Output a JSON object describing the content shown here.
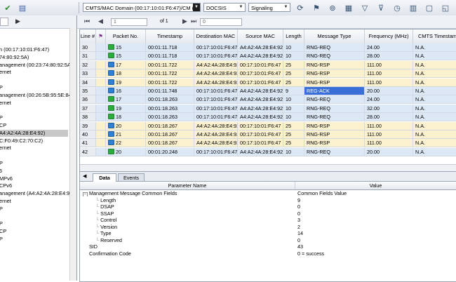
{
  "toolbar": {
    "filter_combo": "CMTS/MAC Domain (00:17:10:01:F6:47)/CM (A4:A2",
    "protocol_combo": "DOCSIS",
    "view_combo": "Signaling",
    "icons": [
      "funnel-check-icon",
      "save-doc-icon",
      "refresh-icon",
      "flag-icon",
      "binoculars-icon",
      "calendar-icon",
      "filter-icon",
      "filter-edit-icon",
      "clock-icon",
      "chart-icon",
      "window-icon"
    ]
  },
  "navigation": {
    "page_value": "1",
    "page_of": "of 1",
    "jump_value": "0"
  },
  "left_tree": {
    "lines": [
      "n (00:17:10:01:F6:47)",
      "74:80:92:5A)",
      "anagement (00:23:74:80:92:5A)",
      "ernet",
      "",
      "P",
      "anagement (00:26:5B:95:5E:84)",
      "ernet",
      "",
      "P",
      "CP",
      "A4:A2:4A:28:E4:92)",
      "C:F0:49:C2:70:C2)",
      "ernet",
      "",
      "P",
      "6",
      "MPv6",
      "CPv6",
      "anagement (A4:A2:4A:28:E4:92)",
      "ernet",
      "P",
      "",
      "P",
      "CP",
      "P"
    ],
    "selected_index": 11
  },
  "grid": {
    "columns": [
      "Line #",
      "⚑",
      "Packet No.",
      "Timestamp",
      "Destination MAC",
      "Source MAC",
      "Length",
      "Message Type",
      "Frequency (MHz)",
      "CMTS Timestam"
    ],
    "rows": [
      {
        "line": "30",
        "packet": "15",
        "timestamp": "00:01:11.718",
        "dst": "00:17:10:01:F6:47",
        "src": "A4:A2:4A:28:E4:92",
        "length": "10",
        "type": "RNG-REQ",
        "freq": "24.00",
        "cmts": "N.A.",
        "color": "#dde8f7",
        "icon": "#2eab3f",
        "selected": false
      },
      {
        "line": "31",
        "packet": "15",
        "timestamp": "00:01:11.718",
        "dst": "00:17:10:01:F6:47",
        "src": "A4:A2:4A:28:E4:92",
        "length": "10",
        "type": "RNG-REQ",
        "freq": "28.00",
        "cmts": "N.A.",
        "color": "#dde8f7",
        "icon": "#2eab3f",
        "selected": false
      },
      {
        "line": "32",
        "packet": "17",
        "timestamp": "00:01:11.722",
        "dst": "A4:A2:4A:28:E4:92",
        "src": "00:17:10:01:F6:47",
        "length": "25",
        "type": "RNG-RSP",
        "freq": "111.00",
        "cmts": "N.A.",
        "color": "#fbf1cf",
        "icon": "#2f7fd6",
        "selected": false
      },
      {
        "line": "33",
        "packet": "18",
        "timestamp": "00:01:11.722",
        "dst": "A4:A2:4A:28:E4:92",
        "src": "00:17:10:01:F6:47",
        "length": "25",
        "type": "RNG-RSP",
        "freq": "111.00",
        "cmts": "N.A.",
        "color": "#fbf1cf",
        "icon": "#2f7fd6",
        "selected": false
      },
      {
        "line": "34",
        "packet": "19",
        "timestamp": "00:01:11.722",
        "dst": "A4:A2:4A:28:E4:92",
        "src": "00:17:10:01:F6:47",
        "length": "25",
        "type": "RNG-RSP",
        "freq": "111.00",
        "cmts": "N.A.",
        "color": "#fbf1cf",
        "icon": "#2f7fd6",
        "selected": false
      },
      {
        "line": "35",
        "packet": "16",
        "timestamp": "00:01:11.748",
        "dst": "00:17:10:01:F6:47",
        "src": "A4:A2:4A:28:E4:92",
        "length": "9",
        "type": "REG-ACK",
        "freq": "20.00",
        "cmts": "N.A.",
        "color": "#dde8f7",
        "icon": "#2f7fd6",
        "selected": true
      },
      {
        "line": "36",
        "packet": "17",
        "timestamp": "00:01:18.263",
        "dst": "00:17:10:01:F6:47",
        "src": "A4:A2:4A:28:E4:92",
        "length": "10",
        "type": "RNG-REQ",
        "freq": "24.00",
        "cmts": "N.A.",
        "color": "#dde8f7",
        "icon": "#2eab3f",
        "selected": false
      },
      {
        "line": "37",
        "packet": "19",
        "timestamp": "00:01:18.263",
        "dst": "00:17:10:01:F6:47",
        "src": "A4:A2:4A:28:E4:92",
        "length": "10",
        "type": "RNG-REQ",
        "freq": "32.00",
        "cmts": "N.A.",
        "color": "#dde8f7",
        "icon": "#2eab3f",
        "selected": false
      },
      {
        "line": "38",
        "packet": "18",
        "timestamp": "00:01:18.263",
        "dst": "00:17:10:01:F6:47",
        "src": "A4:A2:4A:28:E4:92",
        "length": "10",
        "type": "RNG-REQ",
        "freq": "28.00",
        "cmts": "N.A.",
        "color": "#dde8f7",
        "icon": "#2eab3f",
        "selected": false
      },
      {
        "line": "39",
        "packet": "20",
        "timestamp": "00:01:18.267",
        "dst": "A4:A2:4A:28:E4:92",
        "src": "00:17:10:01:F6:47",
        "length": "25",
        "type": "RNG-RSP",
        "freq": "111.00",
        "cmts": "N.A.",
        "color": "#fbf1cf",
        "icon": "#2f7fd6",
        "selected": false
      },
      {
        "line": "40",
        "packet": "21",
        "timestamp": "00:01:18.267",
        "dst": "A4:A2:4A:28:E4:92",
        "src": "00:17:10:01:F6:47",
        "length": "25",
        "type": "RNG-RSP",
        "freq": "111.00",
        "cmts": "N.A.",
        "color": "#fbf1cf",
        "icon": "#2f7fd6",
        "selected": false
      },
      {
        "line": "41",
        "packet": "22",
        "timestamp": "00:01:18.267",
        "dst": "A4:A2:4A:28:E4:92",
        "src": "00:17:10:01:F6:47",
        "length": "25",
        "type": "RNG-RSP",
        "freq": "111.00",
        "cmts": "N.A.",
        "color": "#fbf1cf",
        "icon": "#2f7fd6",
        "selected": false
      },
      {
        "line": "42",
        "packet": "20",
        "timestamp": "00:01:20.248",
        "dst": "00:17:10:01:F6:47",
        "src": "A4:A2:4A:28:E4:92",
        "length": "10",
        "type": "RNG-REQ",
        "freq": "20.00",
        "cmts": "N.A.",
        "color": "#dde8f7",
        "icon": "#2eab3f",
        "selected": false
      }
    ]
  },
  "tabs": [
    {
      "label": "Data",
      "active": true
    },
    {
      "label": "Events",
      "active": false
    }
  ],
  "detail": {
    "columns": [
      "Parameter Name",
      "Value"
    ],
    "rows": [
      {
        "name": "Management Message Common Fields",
        "value": "Common Fields Value",
        "indent": 0,
        "expander": "−"
      },
      {
        "name": "Length",
        "value": "9",
        "indent": 2,
        "expander": ""
      },
      {
        "name": "DSAP",
        "value": "0",
        "indent": 2,
        "expander": ""
      },
      {
        "name": "SSAP",
        "value": "0",
        "indent": 2,
        "expander": ""
      },
      {
        "name": "Control",
        "value": "3",
        "indent": 2,
        "expander": ""
      },
      {
        "name": "Version",
        "value": "2",
        "indent": 2,
        "expander": ""
      },
      {
        "name": "Type",
        "value": "14",
        "indent": 2,
        "expander": ""
      },
      {
        "name": "Reserved",
        "value": "0",
        "indent": 2,
        "expander": ""
      },
      {
        "name": "SID",
        "value": "43",
        "indent": 1,
        "expander": ""
      },
      {
        "name": "Confirmation Code",
        "value": "0 = success",
        "indent": 1,
        "expander": ""
      }
    ]
  }
}
